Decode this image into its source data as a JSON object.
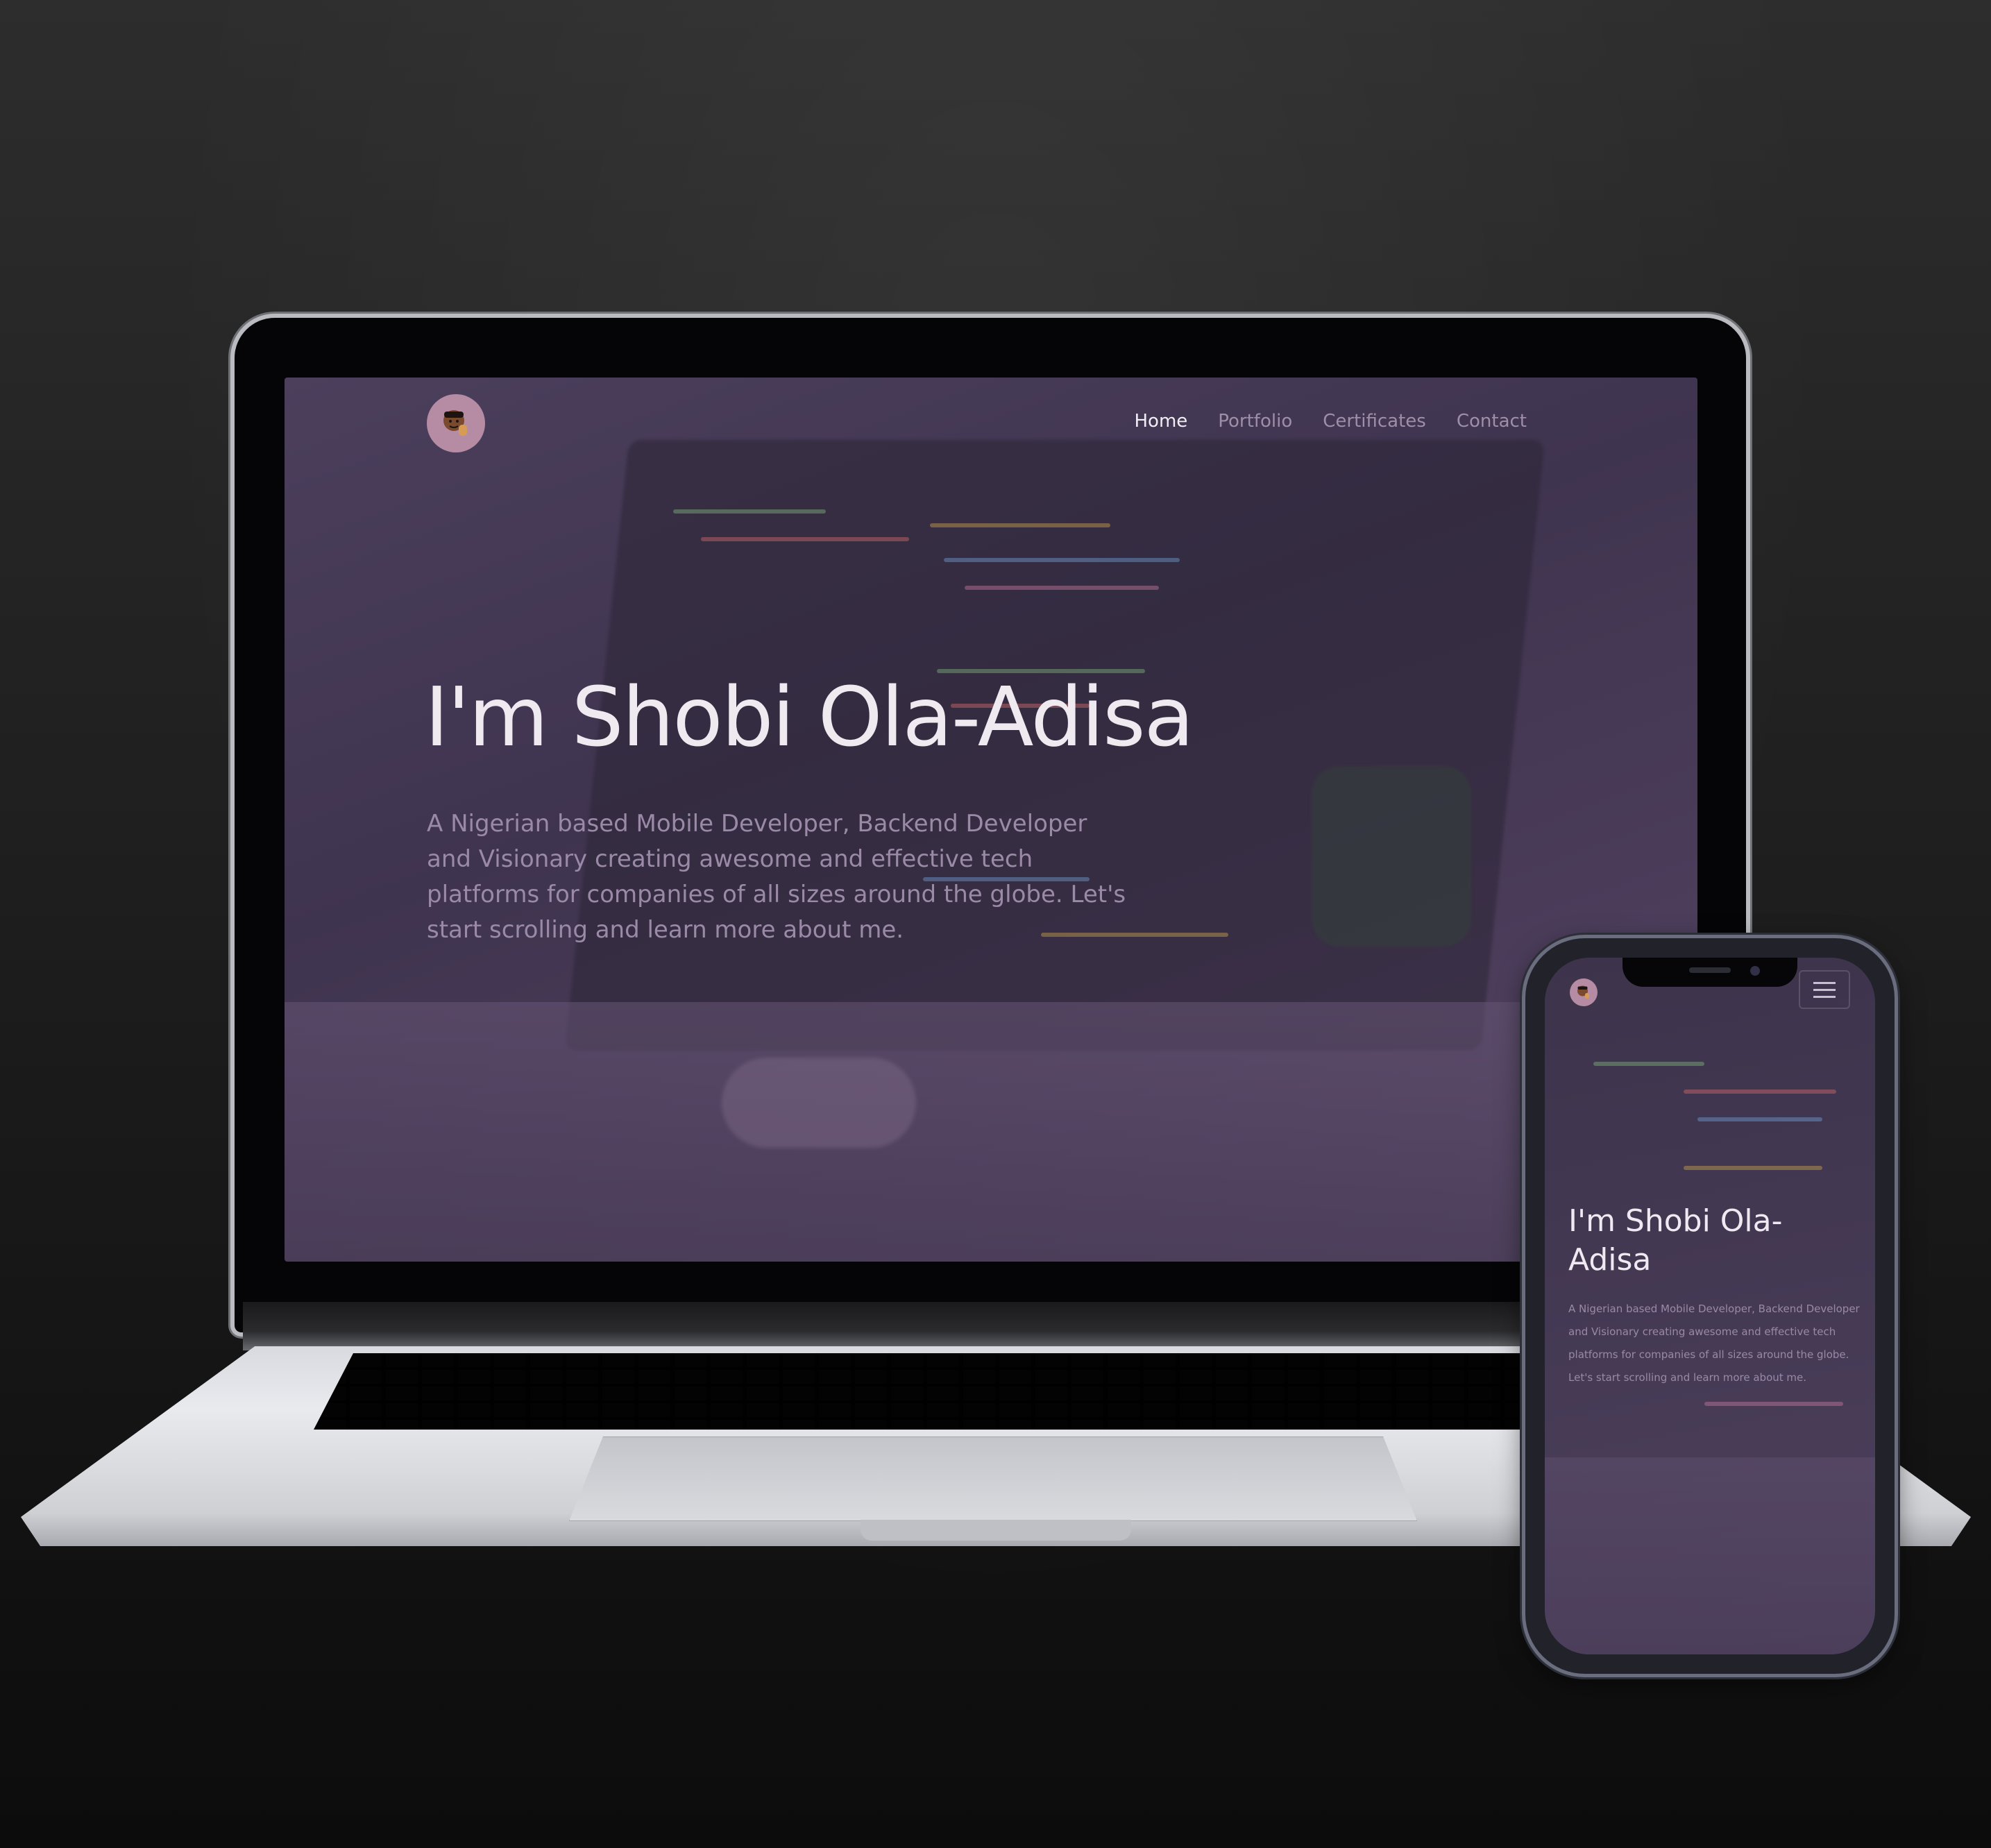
{
  "desktop": {
    "nav": {
      "home": "Home",
      "portfolio": "Portfolio",
      "certificates": "Certificates",
      "contact": "Contact"
    },
    "hero": {
      "title": "I'm Shobi Ola-Adisa",
      "description": "A Nigerian based Mobile Developer, Backend Developer and Visionary creating awesome and effective tech platforms for companies of all sizes around the globe. Let's start scrolling and learn more about me."
    }
  },
  "mobile": {
    "hero": {
      "title": "I'm Shobi Ola-Adisa",
      "description": "A Nigerian based Mobile Developer, Backend Developer and Visionary creating awesome and effective tech platforms for companies of all sizes around the globe. Let's start scrolling and learn more about me."
    },
    "menu_icon": "hamburger-icon"
  },
  "icons": {
    "logo": "avatar-memoji-icon"
  },
  "colors": {
    "overlay": "#463b55",
    "nav_active": "#f1eef3",
    "nav_inactive": "#9f8ea8",
    "logo_bg": "#b58ca3"
  }
}
